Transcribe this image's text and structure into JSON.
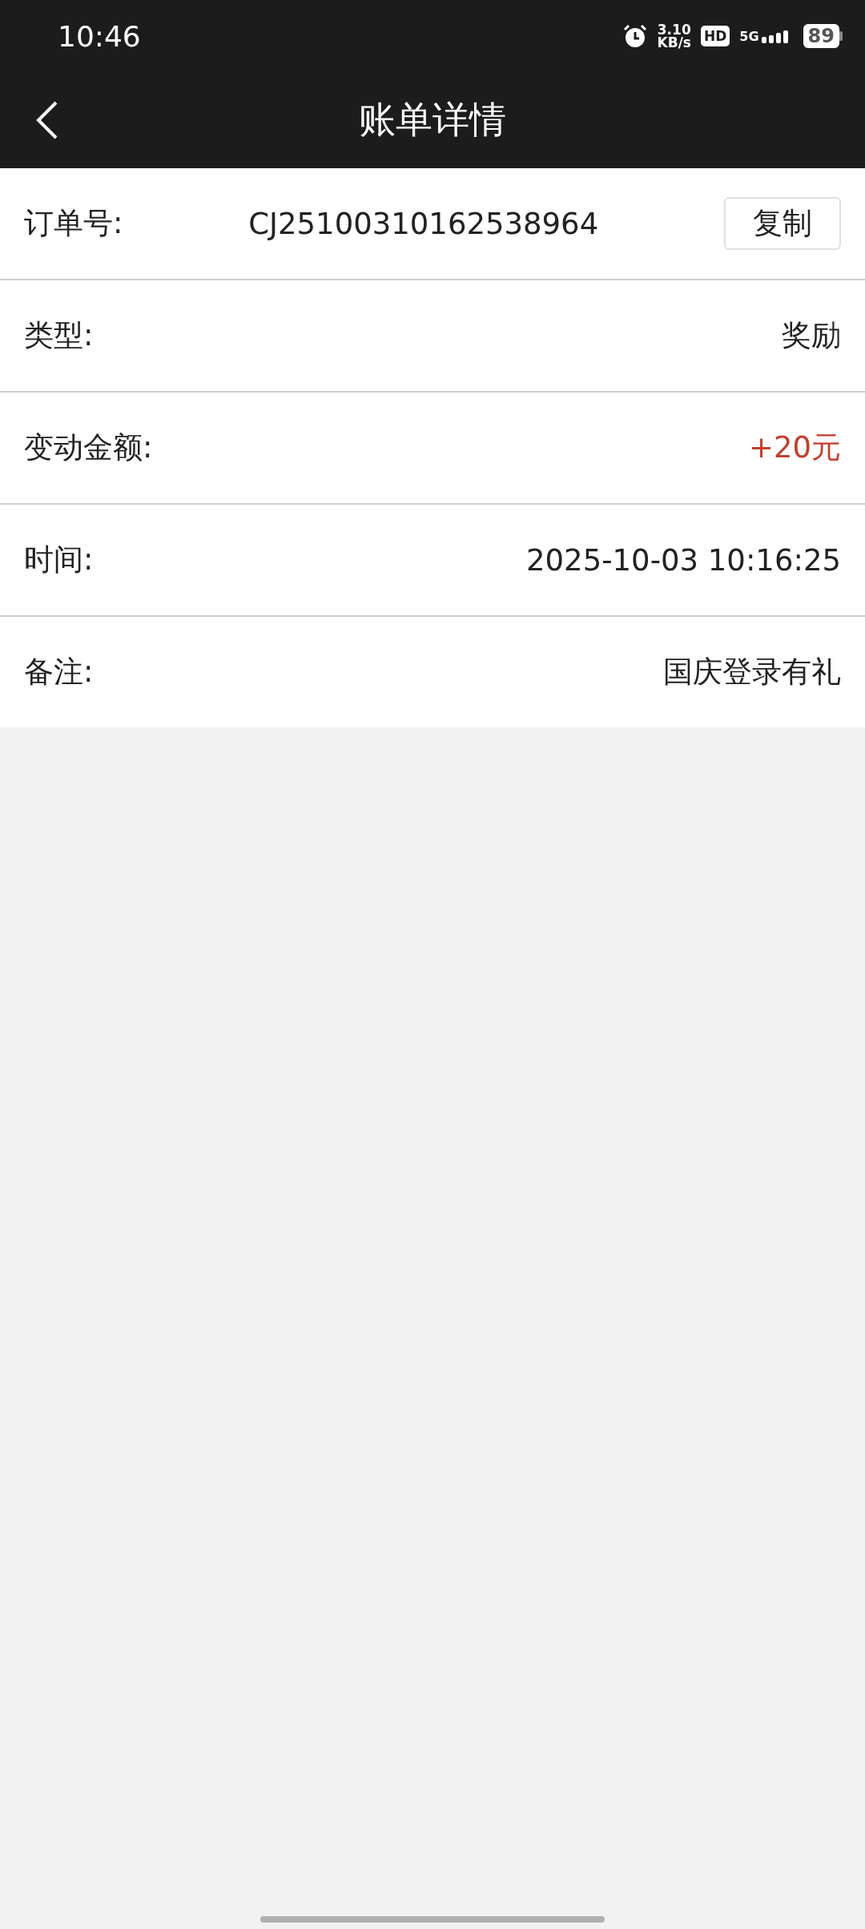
{
  "status_bar": {
    "time": "10:46",
    "speed": "3.10",
    "speed_unit": "KB/s",
    "hd": "HD",
    "network": "5G",
    "battery": "89"
  },
  "header": {
    "title": "账单详情"
  },
  "rows": [
    {
      "kind": "order",
      "label": "订单号:",
      "value": "CJ25100310162538964",
      "button": "复制"
    },
    {
      "kind": "text",
      "label": "类型:",
      "value": "奖励"
    },
    {
      "kind": "amount",
      "label": "变动金额:",
      "value": "+20元"
    },
    {
      "kind": "text",
      "label": "时间:",
      "value": "2025-10-03 10:16:25"
    },
    {
      "kind": "text",
      "label": "备注:",
      "value": "国庆登录有礼"
    }
  ]
}
